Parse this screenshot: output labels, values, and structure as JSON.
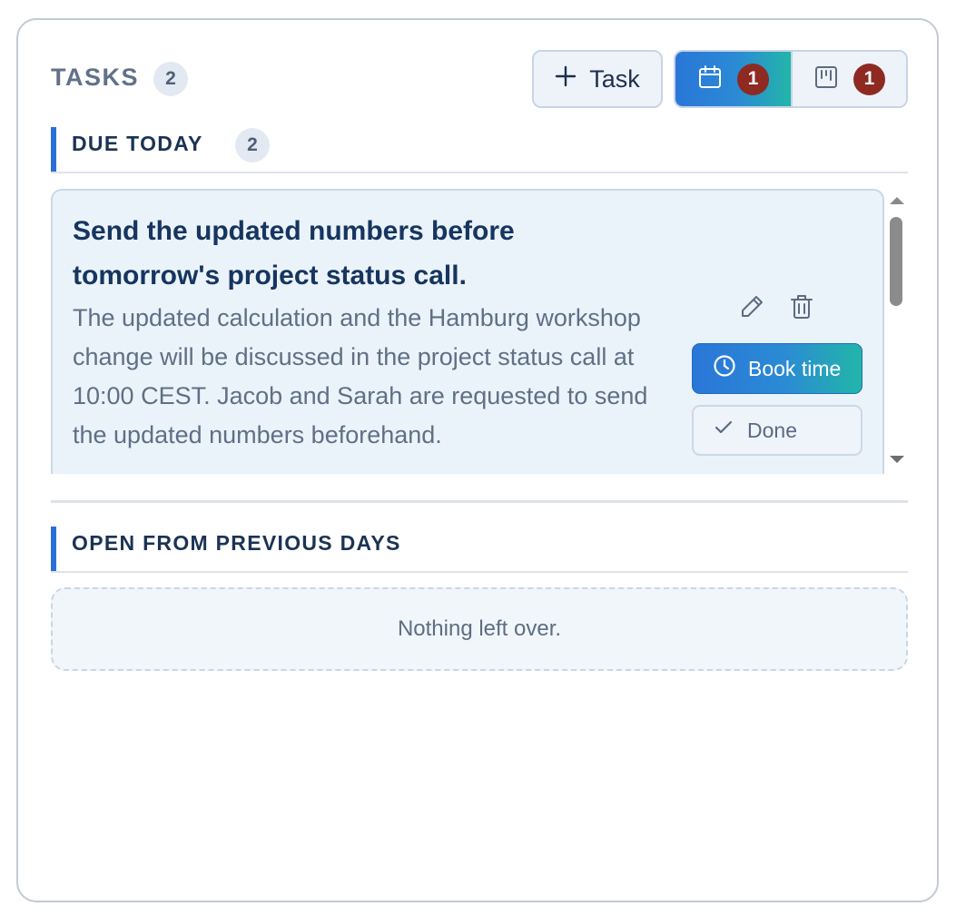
{
  "header": {
    "title": "TASKS",
    "task_count": "2",
    "add_button_label": "Task",
    "view_toggle": {
      "calendar_view_count": "1",
      "board_view_count": "1",
      "active_view": "calendar"
    }
  },
  "sections": {
    "due_today": {
      "label": "DUE TODAY",
      "count": "2",
      "tasks": [
        {
          "title": "Send the updated numbers before tomorrow's project status call.",
          "description": "The updated calculation and the Hamburg workshop change will be discussed in the project status call at 10:00 CEST. Jacob and Sarah are requested to send the updated numbers beforehand.",
          "book_time_label": "Book time",
          "done_label": "Done"
        }
      ]
    },
    "previous_days": {
      "label": "OPEN FROM PREVIOUS DAYS",
      "empty_text": "Nothing left over."
    }
  },
  "icons": {
    "add": "plus-icon",
    "calendar_view": "calendar-icon",
    "board_view": "kanban-board-icon",
    "edit": "pencil-icon",
    "delete": "trash-icon",
    "book_time": "clock-icon",
    "done": "check-icon"
  },
  "colors": {
    "accent": "#2a6fd6",
    "gradient_start": "#2a76d8",
    "gradient_end": "#22b6a8",
    "alert_badge": "#8e2a22",
    "title_text": "#163560"
  }
}
